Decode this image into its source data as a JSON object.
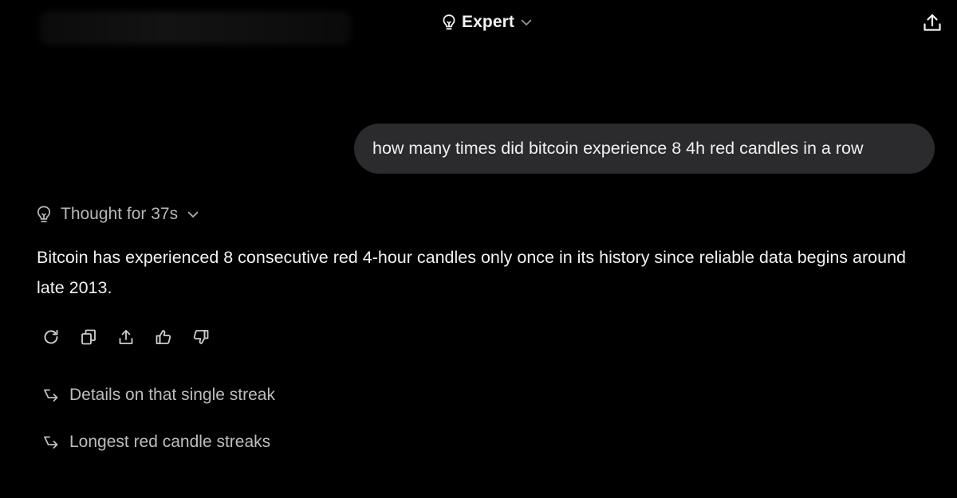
{
  "header": {
    "model_label": "Expert",
    "model_icon": "lightbulb-icon",
    "dropdown_icon": "chevron-down-icon",
    "share_icon": "share-upload-icon"
  },
  "conversation": {
    "user_message": "how many times did bitcoin experience 8 4h red candles in a row",
    "thought_label": "Thought for 37s",
    "answer_text": "Bitcoin has experienced 8 consecutive red 4-hour candles only once in its history since reliable data begins around late 2013."
  },
  "actions": [
    {
      "icon": "regenerate-icon"
    },
    {
      "icon": "copy-icon"
    },
    {
      "icon": "share-icon"
    },
    {
      "icon": "thumbs-up-icon"
    },
    {
      "icon": "thumbs-down-icon"
    }
  ],
  "suggestions": [
    {
      "label": "Details on that single streak",
      "icon": "follow-up-arrow-icon"
    },
    {
      "label": "Longest red candle streaks",
      "icon": "follow-up-arrow-icon"
    }
  ],
  "colors": {
    "background": "#000000",
    "bubble": "#2b2b2d",
    "text_primary": "#f2f2f2",
    "text_muted": "#b8b8b8"
  }
}
